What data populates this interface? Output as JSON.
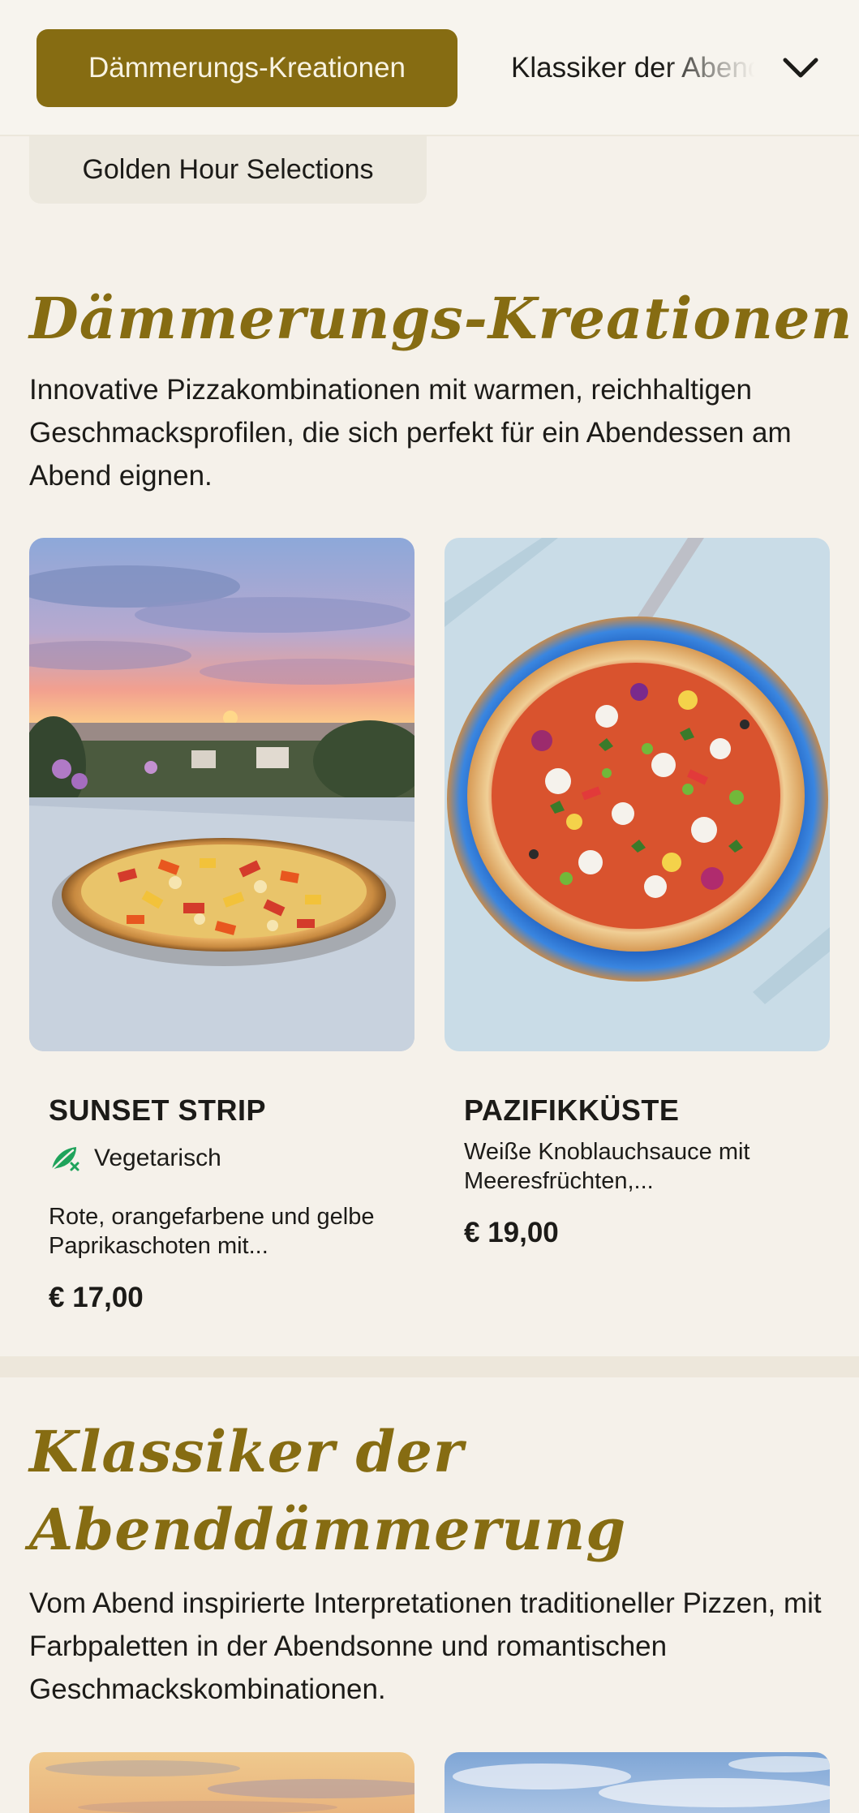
{
  "nav": {
    "active_category": "Dämmerungs-Kreationen",
    "next_category": "Klassiker der Abenddämmerung",
    "second_row_category": "Golden Hour Selections"
  },
  "sections": [
    {
      "title": "Dämmerungs-Kreationen",
      "description": "Innovative Pizzakombinationen mit warmen, reichhaltigen Geschmacksprofilen, die sich perfekt für ein Abendessen am Abend eignen.",
      "items": [
        {
          "name": "SUNSET STRIP",
          "tag": "Vegetarisch",
          "tag_icon": "vegetarian-leaf-icon",
          "description": "Rote, orangefarbene und gelbe Paprikaschoten mit...",
          "price": "€ 17,00"
        },
        {
          "name": "PAZIFIKKÜSTE",
          "description": "Weiße Knoblauchsauce mit Meeresfrüchten,...",
          "price": "€ 19,00"
        }
      ]
    },
    {
      "title": "Klassiker der Abenddämmerung",
      "description": "Vom Abend inspirierte Interpretationen traditioneller Pizzen, mit Farbpaletten in der Abendsonne und romantischen Geschmackskombinationen."
    }
  ],
  "colors": {
    "accent": "#866c12",
    "background": "#f5f1ea",
    "veg_icon": "#1fa35b"
  }
}
